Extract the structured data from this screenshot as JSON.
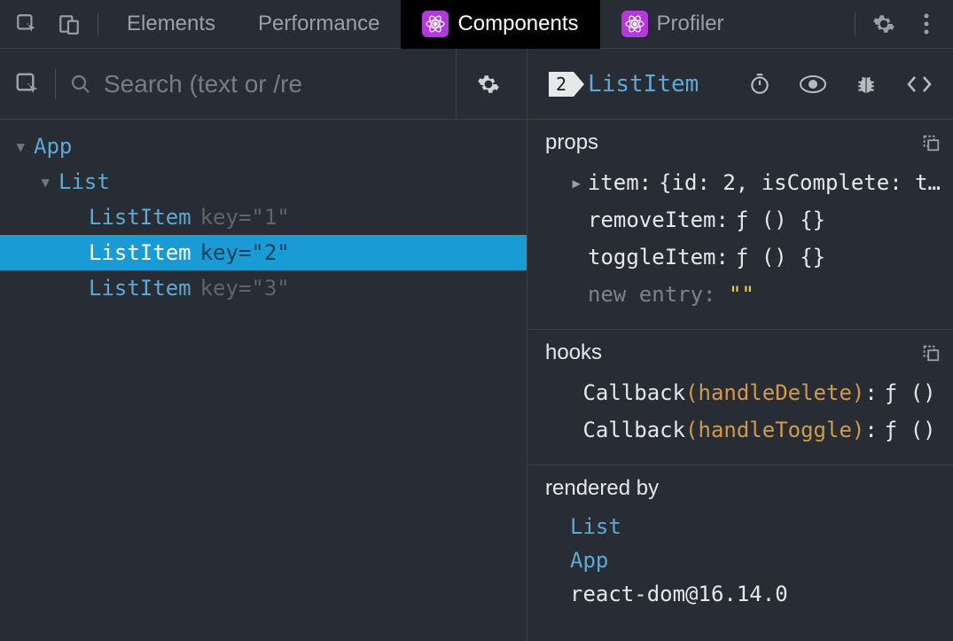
{
  "top": {
    "tabs": {
      "elements": "Elements",
      "performance": "Performance",
      "components": "Components",
      "profiler": "Profiler"
    }
  },
  "search": {
    "placeholder": "Search (text or /re"
  },
  "tree": {
    "app": "App",
    "list": "List",
    "items": [
      {
        "name": "ListItem",
        "key": "1",
        "selected": false
      },
      {
        "name": "ListItem",
        "key": "2",
        "selected": true
      },
      {
        "name": "ListItem",
        "key": "3",
        "selected": false
      }
    ],
    "key_label": "key="
  },
  "selected": {
    "badge": "2",
    "name": "ListItem"
  },
  "props": {
    "heading": "props",
    "item_key": "item",
    "item_val": "{id: 2, isComplete: t…",
    "removeItem_key": "removeItem",
    "removeItem_val": "ƒ () {}",
    "toggleItem_key": "toggleItem",
    "toggleItem_val": "ƒ () {}",
    "new_entry_label": "new entry",
    "new_entry_val": "\"\""
  },
  "hooks": {
    "heading": "hooks",
    "cb_label": "Callback",
    "cb1_name": "handleDelete",
    "cb2_name": "handleToggle",
    "fn_val": "ƒ () {}"
  },
  "rendered": {
    "heading": "rendered by",
    "list": "List",
    "app": "App",
    "dom": "react-dom@16.14.0"
  }
}
